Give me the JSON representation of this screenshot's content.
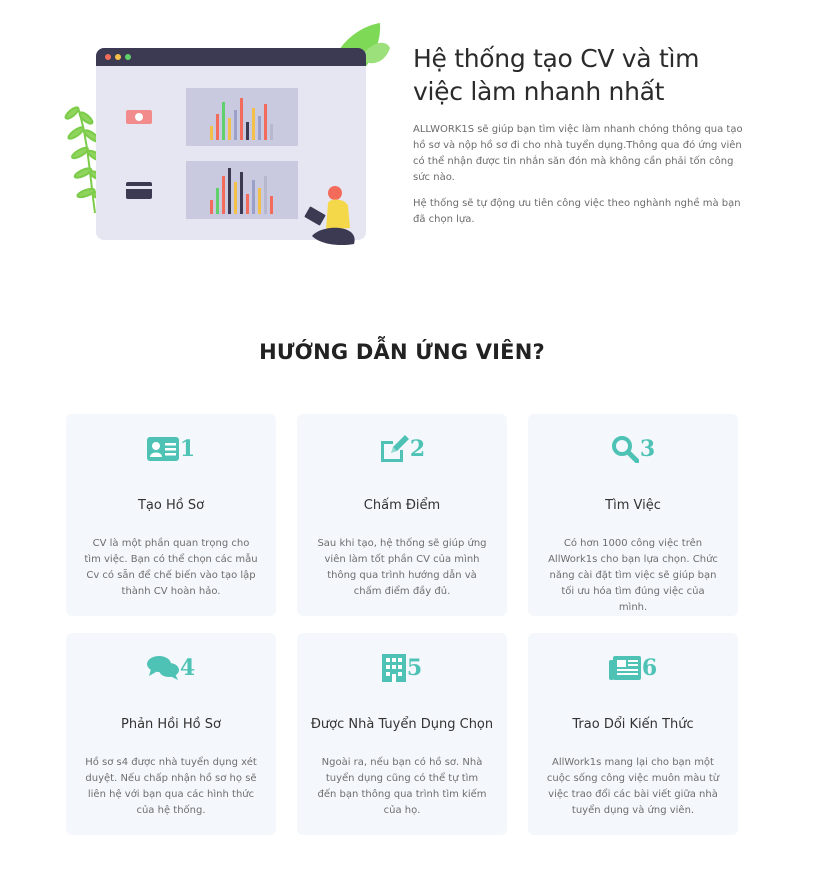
{
  "hero": {
    "title": "Hệ thống tạo CV và tìm việc làm nhanh nhất",
    "paragraph1": "ALLWORK1S sẽ giúp bạn tìm việc làm nhanh chóng thông qua tạo hồ sơ và nộp hồ sơ đi cho nhà tuyển dụng.Thông qua đó ứng viên có thể nhận được tin nhắn săn đón mà không cần phải tốn công sức nào.",
    "paragraph2": "Hệ thống sẽ tự động ưu tiên công việc theo nghành nghề mà bạn đã chọn lựa."
  },
  "guide": {
    "title": "HƯỚNG DẪN ỨNG VIÊN?",
    "accent_color": "#4ec3b5",
    "cards": [
      {
        "number": "1",
        "icon": "id-card-icon",
        "title": "Tạo Hồ Sơ",
        "desc": "CV là một phần quan trọng cho tìm việc. Bạn có thể chọn các mẫu Cv có sẵn để chế biến vào tạo lập thành CV hoàn hảo."
      },
      {
        "number": "2",
        "icon": "edit-icon",
        "title": "Chấm Điểm",
        "desc": "Sau khi tạo, hệ thống sẽ giúp ứng viên làm tốt phần CV của mình thông qua trình hướng dẫn và chấm điểm đầy đủ."
      },
      {
        "number": "3",
        "icon": "search-icon",
        "title": "Tìm Việc",
        "desc": "Có hơn 1000 công việc trên AllWork1s cho bạn lựa chọn. Chức năng cài đặt tìm việc sẽ giúp bạn tối ưu hóa tìm đúng việc của mình."
      },
      {
        "number": "4",
        "icon": "comments-icon",
        "title": "Phản Hồi Hồ Sơ",
        "desc": "Hồ sơ s4 được nhà tuyển dụng xét duyệt. Nếu chấp nhận hồ sơ họ sẽ liên hệ với bạn qua các hình thức của hệ thống."
      },
      {
        "number": "5",
        "icon": "building-icon",
        "title": "Được Nhà Tuyển Dụng Chọn",
        "desc": "Ngoài ra, nếu bạn có hồ sơ. Nhà tuyển dụng cũng có thể tự tìm đến bạn thông qua trình tìm kiếm của họ."
      },
      {
        "number": "6",
        "icon": "newspaper-icon",
        "title": "Trao Dổi Kiến Thức",
        "desc": "AllWork1s mang lại cho bạn một cuộc sống công việc muôn màu từ việc trao đổi các bài viết giữa nhà tuyển dụng và ứng viên."
      }
    ]
  }
}
